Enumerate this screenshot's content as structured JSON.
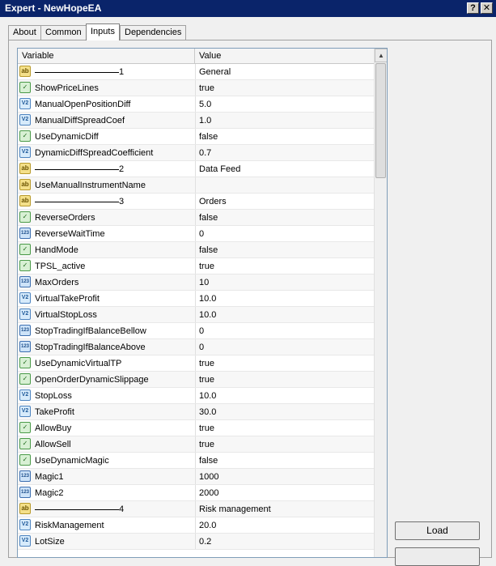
{
  "window": {
    "title": "Expert - NewHopeEA",
    "help_label": "?",
    "close_label": "✕"
  },
  "tabs": [
    {
      "label": "About"
    },
    {
      "label": "Common"
    },
    {
      "label": "Inputs",
      "active": true
    },
    {
      "label": "Dependencies"
    }
  ],
  "grid": {
    "header": {
      "variable": "Variable",
      "value": "Value"
    },
    "rows": [
      {
        "type": "string",
        "separator": true,
        "index": "1",
        "value": "General"
      },
      {
        "type": "bool",
        "name": "ShowPriceLines",
        "value": "true"
      },
      {
        "type": "double",
        "name": "ManualOpenPositionDiff",
        "value": "5.0"
      },
      {
        "type": "double",
        "name": "ManualDiffSpreadCoef",
        "value": "1.0"
      },
      {
        "type": "bool",
        "name": "UseDynamicDiff",
        "value": "false"
      },
      {
        "type": "double",
        "name": "DynamicDiffSpreadCoefficient",
        "value": "0.7"
      },
      {
        "type": "string",
        "separator": true,
        "index": "2",
        "value": "Data Feed"
      },
      {
        "type": "string",
        "name": "UseManualInstrumentName",
        "value": ""
      },
      {
        "type": "string",
        "separator": true,
        "index": "3",
        "value": "Orders"
      },
      {
        "type": "bool",
        "name": "ReverseOrders",
        "value": "false"
      },
      {
        "type": "int",
        "name": "ReverseWaitTime",
        "value": "0"
      },
      {
        "type": "bool",
        "name": "HandMode",
        "value": "false"
      },
      {
        "type": "bool",
        "name": "TPSL_active",
        "value": "true"
      },
      {
        "type": "int",
        "name": "MaxOrders",
        "value": "10"
      },
      {
        "type": "double",
        "name": "VirtualTakeProfit",
        "value": "10.0"
      },
      {
        "type": "double",
        "name": "VirtualStopLoss",
        "value": "10.0"
      },
      {
        "type": "int",
        "name": "StopTradingIfBalanceBellow",
        "value": "0"
      },
      {
        "type": "int",
        "name": "StopTradingIfBalanceAbove",
        "value": "0"
      },
      {
        "type": "bool",
        "name": "UseDynamicVirtualTP",
        "value": "true"
      },
      {
        "type": "bool",
        "name": "OpenOrderDynamicSlippage",
        "value": "true"
      },
      {
        "type": "double",
        "name": "StopLoss",
        "value": "10.0"
      },
      {
        "type": "double",
        "name": "TakeProfit",
        "value": "30.0"
      },
      {
        "type": "bool",
        "name": "AllowBuy",
        "value": "true"
      },
      {
        "type": "bool",
        "name": "AllowSell",
        "value": "true"
      },
      {
        "type": "bool",
        "name": "UseDynamicMagic",
        "value": "false"
      },
      {
        "type": "int",
        "name": "Magic1",
        "value": "1000"
      },
      {
        "type": "int",
        "name": "Magic2",
        "value": "2000"
      },
      {
        "type": "string",
        "separator": true,
        "index": "4",
        "value": "Risk management"
      },
      {
        "type": "double",
        "name": "RiskManagement",
        "value": "20.0"
      },
      {
        "type": "double",
        "name": "LotSize",
        "value": "0.2"
      }
    ]
  },
  "icon_glyphs": {
    "string": "ab",
    "bool": "✓",
    "double": "V2",
    "int": "123"
  },
  "buttons": {
    "load": "Load"
  }
}
